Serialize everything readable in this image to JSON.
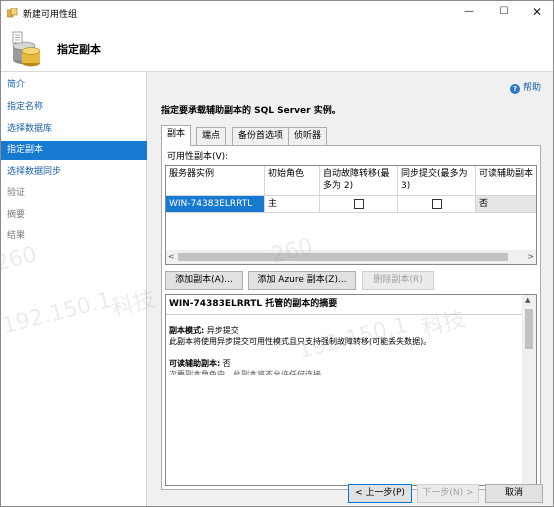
{
  "window": {
    "title": "新建可用性组",
    "min_glyph": "—",
    "max_glyph": "☐",
    "close_glyph": "✕"
  },
  "header": {
    "title": "指定副本",
    "icon": "availability-group-wizard-icon"
  },
  "sidebar": {
    "items": [
      {
        "label": "简介",
        "state": "normal"
      },
      {
        "label": "指定名称",
        "state": "normal"
      },
      {
        "label": "选择数据库",
        "state": "normal"
      },
      {
        "label": "指定副本",
        "state": "selected"
      },
      {
        "label": "选择数据同步",
        "state": "normal"
      },
      {
        "label": "验证",
        "state": "disabled"
      },
      {
        "label": "摘要",
        "state": "disabled"
      },
      {
        "label": "结果",
        "state": "disabled"
      }
    ]
  },
  "main": {
    "help_label": "帮助",
    "instruction": "指定要承载辅助副本的 SQL Server 实例。",
    "tabs": [
      {
        "label": "副本",
        "active": true
      },
      {
        "label": "端点",
        "active": false
      },
      {
        "label": "备份首选项",
        "active": false
      },
      {
        "label": "侦听器",
        "active": false
      }
    ],
    "replicas_label": "可用性副本(V):",
    "grid": {
      "columns": [
        "服务器实例",
        "初始角色",
        "自动故障转移(最多为 2)",
        "同步提交(最多为 3)",
        "可读辅助副本"
      ],
      "rows": [
        {
          "server": "WIN-74383ELRRTL",
          "role": "主",
          "auto_failover": false,
          "sync_commit": false,
          "readable": "否"
        }
      ]
    },
    "buttons": {
      "add_replica": "添加副本(A)...",
      "add_azure": "添加 Azure 副本(Z)...",
      "remove_replica": "删除副本(R)"
    },
    "summary": {
      "title": "WIN-74383ELRRTL 托管的副本的摘要",
      "mode_label": "副本模式:",
      "mode_value": "异步提交",
      "mode_desc": "此副本将使用异步提交可用性模式且只支持强制故障转移(可能丢失数据)。",
      "readable_label": "可读辅助副本:",
      "readable_value": "否",
      "cut_line": "次要副本角色中，此副本将不允许任何连接。"
    }
  },
  "footer": {
    "prev": "< 上一步(P)",
    "next": "下一步(N) >",
    "cancel": "取消"
  },
  "watermark": {
    "ip": "192.150.1",
    "digits": "260",
    "tech": "科技"
  },
  "colors": {
    "selection": "#1879d0",
    "link": "#1a5fa8"
  }
}
